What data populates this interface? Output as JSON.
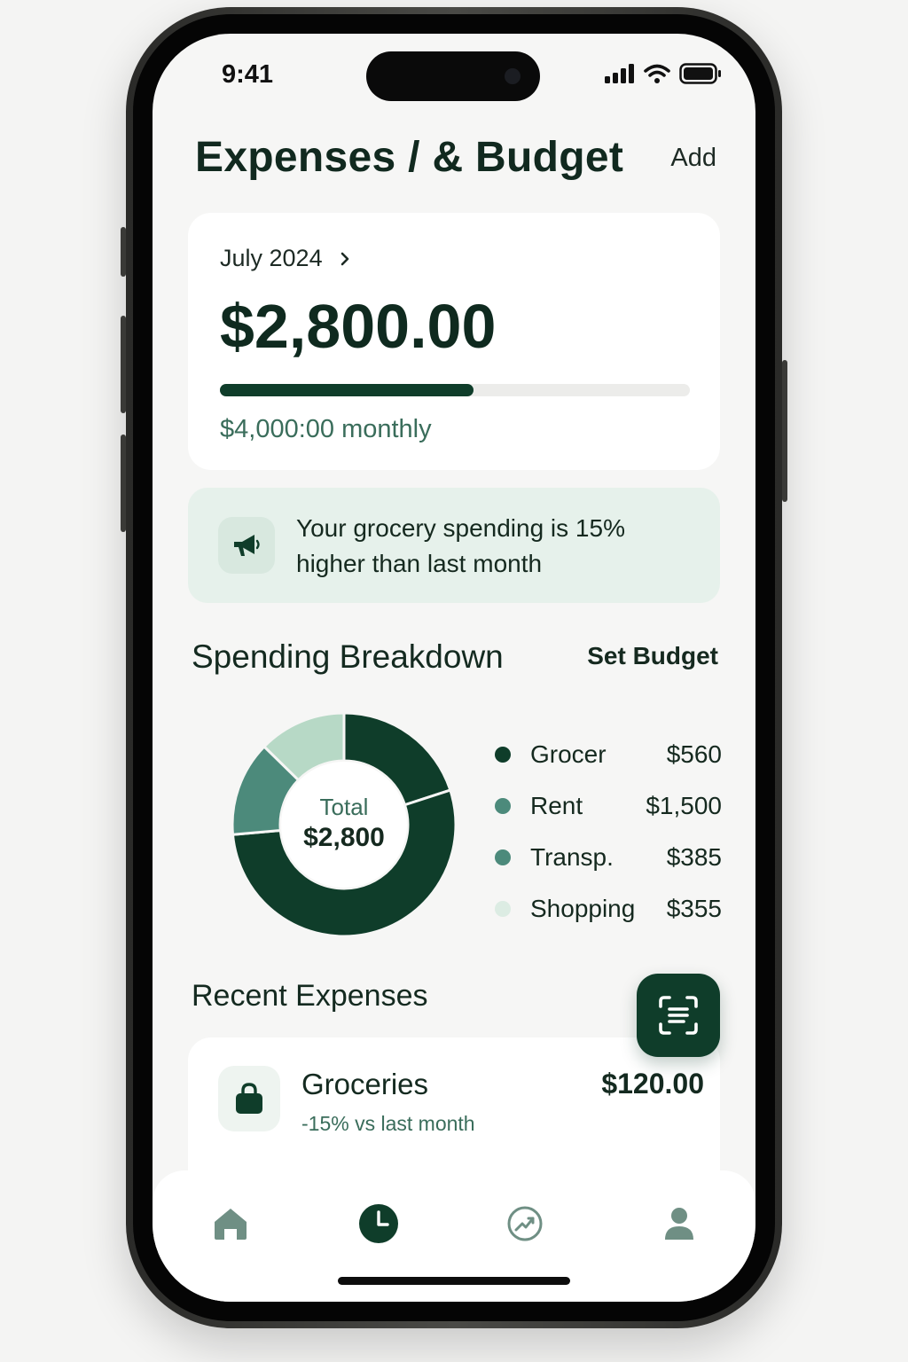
{
  "status_bar": {
    "time": "9:41"
  },
  "header": {
    "title": "Expenses / & Budget",
    "add_label": "Add"
  },
  "budget_card": {
    "month": "July 2024",
    "spent": "$2,800.00",
    "monthly_budget": "$4,000:00 monthly",
    "progress_fraction": 0.54
  },
  "tip": {
    "text": "Your grocery spending is 15% higher than last month"
  },
  "breakdown": {
    "title": "Spending Breakdown",
    "set_budget_label": "Set Budget",
    "total_label": "Total",
    "total_value": "$2,800"
  },
  "chart_data": {
    "type": "pie",
    "categories": [
      "Grocer",
      "Rent",
      "Transp.",
      "Shopping"
    ],
    "values": [
      560,
      1500,
      385,
      355
    ],
    "value_labels": [
      "$560",
      "$1,500",
      "$385",
      "$355"
    ],
    "colors": [
      "#0f3d2a",
      "#0f3d2a",
      "#4c8a7b",
      "#b7d9c6"
    ],
    "legend_colors": [
      "#0f3d2a",
      "#4c8a7b",
      "#4c8a7b",
      "#dcece3"
    ]
  },
  "recent": {
    "title": "Recent Expenses",
    "items": [
      {
        "name": "Groceries",
        "sub": "-15% vs last month",
        "amount": "$120.00",
        "icon": "shopping-bag-icon"
      }
    ]
  },
  "tab_bar": {
    "items": [
      {
        "name": "home",
        "icon": "home-icon",
        "active": false
      },
      {
        "name": "history",
        "icon": "clock-icon",
        "active": true
      },
      {
        "name": "analytics",
        "icon": "trend-icon",
        "active": false
      },
      {
        "name": "profile",
        "icon": "user-icon",
        "active": false
      }
    ]
  },
  "colors": {
    "primary": "#0f3d2a",
    "accent": "#3a6d5b",
    "tip_bg": "#e6f1eb"
  }
}
